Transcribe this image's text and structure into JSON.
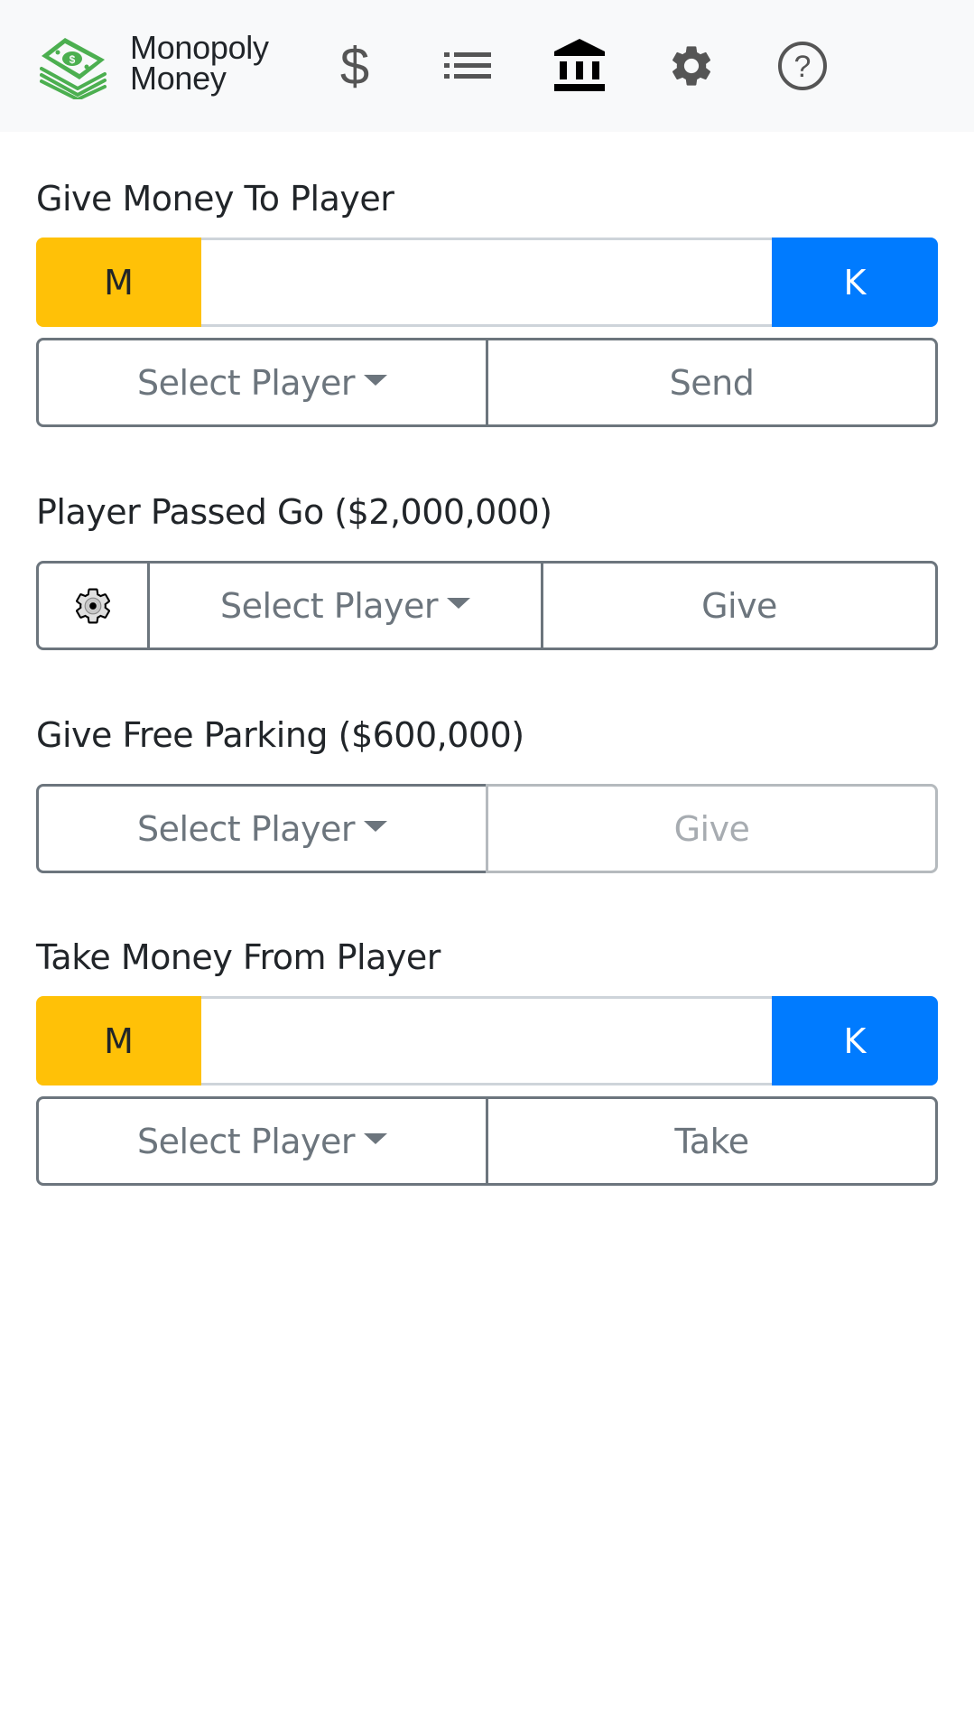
{
  "navbar": {
    "brand_line1": "Monopoly",
    "brand_line2": "Money",
    "logo_icon": "money-stack-icon",
    "nav_items": [
      {
        "icon": "dollar-icon",
        "active": false
      },
      {
        "icon": "list-icon",
        "active": false
      },
      {
        "icon": "bank-icon",
        "active": true
      },
      {
        "icon": "gear-icon",
        "active": false
      },
      {
        "icon": "help-circle-icon",
        "active": false
      }
    ]
  },
  "give_money": {
    "title": "Give Money To Player",
    "millions_label": "M",
    "thousands_label": "K",
    "amount_value": "",
    "select_player_label": "Select Player",
    "send_label": "Send"
  },
  "passed_go": {
    "title": "Player Passed Go ($2,000,000)",
    "settings_icon": "gear-icon",
    "select_player_label": "Select Player",
    "give_label": "Give"
  },
  "free_parking": {
    "title": "Give Free Parking ($600,000)",
    "select_player_label": "Select Player",
    "give_label": "Give",
    "give_disabled": true
  },
  "take_money": {
    "title": "Take Money From Player",
    "millions_label": "M",
    "thousands_label": "K",
    "amount_value": "",
    "select_player_label": "Select Player",
    "take_label": "Take"
  },
  "colors": {
    "millions": "#ffc107",
    "thousands": "#007bff",
    "outline": "#6c757d",
    "brand_green": "#4caf50"
  }
}
